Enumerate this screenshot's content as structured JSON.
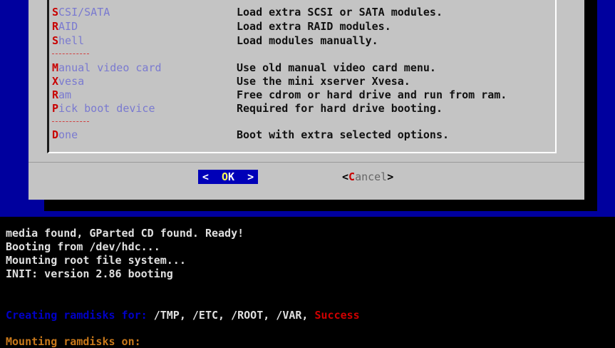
{
  "dialog": {
    "items": [
      {
        "hotkey": "S",
        "rest": "CSI/SATA",
        "desc": "Load extra SCSI or SATA modules."
      },
      {
        "hotkey": "R",
        "rest": "AID",
        "desc": "Load extra RAID modules."
      },
      {
        "hotkey": "S",
        "rest": "hell",
        "desc": "Load modules manually."
      },
      {
        "separator": true
      },
      {
        "hotkey": "M",
        "rest": "anual video card",
        "desc": "Use old manual video card menu."
      },
      {
        "hotkey": "X",
        "rest": "vesa",
        "desc": "Use the mini xserver Xvesa."
      },
      {
        "hotkey": "R",
        "rest": "am",
        "desc": "Free cdrom or hard drive and run from ram."
      },
      {
        "hotkey": "P",
        "rest": "ick boot device",
        "desc": "Required for hard drive booting."
      },
      {
        "separator": true
      },
      {
        "hotkey": "D",
        "rest": "one",
        "desc": "Boot with extra selected options."
      }
    ],
    "ok_button": {
      "left": "<  ",
      "hot": "O",
      "rest": "K",
      "right": "  >"
    },
    "cancel_button": {
      "open": "<",
      "hot": "C",
      "rest": "ancel",
      "close": ">"
    }
  },
  "console": {
    "lines": [
      "media found, GParted CD found. Ready!",
      "Booting from /dev/hdc...",
      "Mounting root file system...",
      "INIT: version 2.86 booting"
    ],
    "ramdisk_line": {
      "prefix": "Creating ramdisks for: ",
      "paths": "/TMP, /ETC, /ROOT, /VAR, ",
      "status": "Success"
    },
    "mount_line": "Mounting ramdisks on:"
  },
  "colors": {
    "screen_bg": "#00009e",
    "dialog_bg": "#c4c4c4",
    "hotkey": "#c80000",
    "selected_button_bg": "#0000b8"
  }
}
